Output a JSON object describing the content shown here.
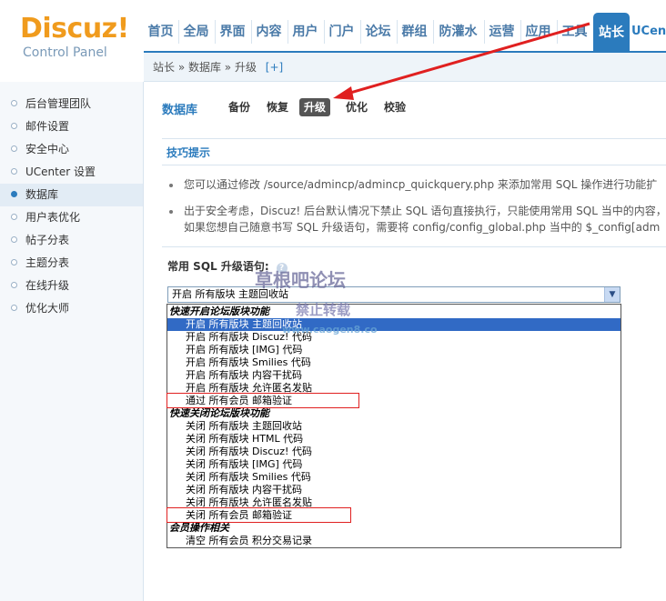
{
  "logo": {
    "main": "Discuz!",
    "sub": "Control Panel"
  },
  "nav": {
    "items": [
      "首页",
      "全局",
      "界面",
      "内容",
      "用户",
      "门户",
      "论坛",
      "群组",
      "防灌水",
      "运营",
      "应用",
      "工具"
    ],
    "active": "站长",
    "extra": "UCen"
  },
  "breadcrumb": {
    "text": "站长 » 数据库 » 升级",
    "plus": "[+]"
  },
  "sidebar": {
    "items": [
      "后台管理团队",
      "邮件设置",
      "安全中心",
      "UCenter 设置",
      "数据库",
      "用户表优化",
      "帖子分表",
      "主题分表",
      "在线升级",
      "优化大师"
    ],
    "active_index": 4
  },
  "main": {
    "title": "数据库",
    "tabs": [
      "备份",
      "恢复",
      "升级",
      "优化",
      "校验"
    ],
    "active_tab": "升级",
    "tips_head": "技巧提示",
    "tip1": "您可以通过修改 /source/admincp/admincp_quickquery.php 来添加常用 SQL 操作进行功能扩",
    "tip2a": "出于安全考虑，Discuz! 后台默认情况下禁止 SQL 语句直接执行，只能使用常用 SQL 当中的内容，",
    "tip2b": "如果您想自己随意书写 SQL 升级语句，需要将 config/config_global.php 当中的 $_config[adm",
    "sql_label": "常用 SQL 升级语句:",
    "help": "?",
    "select_value": "开启 所有版块 主题回收站"
  },
  "dropdown": [
    {
      "text": "快速开启论坛版块功能",
      "type": "group"
    },
    {
      "text": "开启 所有版块 主题回收站",
      "type": "selected"
    },
    {
      "text": "开启 所有版块 Discuz! 代码",
      "type": "option"
    },
    {
      "text": "开启 所有版块 [IMG] 代码",
      "type": "option"
    },
    {
      "text": "开启 所有版块 Smilies 代码",
      "type": "option"
    },
    {
      "text": "开启 所有版块 内容干扰码",
      "type": "option"
    },
    {
      "text": "开启 所有版块 允许匿名发贴",
      "type": "option"
    },
    {
      "text": "通过 所有会员 邮箱验证",
      "type": "option"
    },
    {
      "text": "快速关闭论坛版块功能",
      "type": "group"
    },
    {
      "text": "关闭 所有版块 主题回收站",
      "type": "option"
    },
    {
      "text": "关闭 所有版块 HTML 代码",
      "type": "option"
    },
    {
      "text": "关闭 所有版块 Discuz! 代码",
      "type": "option"
    },
    {
      "text": "关闭 所有版块 [IMG] 代码",
      "type": "option"
    },
    {
      "text": "关闭 所有版块 Smilies 代码",
      "type": "option"
    },
    {
      "text": "关闭 所有版块 内容干扰码",
      "type": "option"
    },
    {
      "text": "关闭 所有版块 允许匿名发贴",
      "type": "option"
    },
    {
      "text": "关闭 所有会员 邮箱验证",
      "type": "option"
    },
    {
      "text": "会员操作相关",
      "type": "group"
    },
    {
      "text": "清空 所有会员 积分交易记录",
      "type": "option"
    }
  ],
  "watermark": {
    "line1": "草根吧论坛",
    "line2": "禁止转载",
    "line3": "www.caogen8.co"
  },
  "colors": {
    "accent": "#2b7bbd",
    "logo": "#f09b1d",
    "highlight": "#316ac5",
    "annotation": "#e02020"
  }
}
